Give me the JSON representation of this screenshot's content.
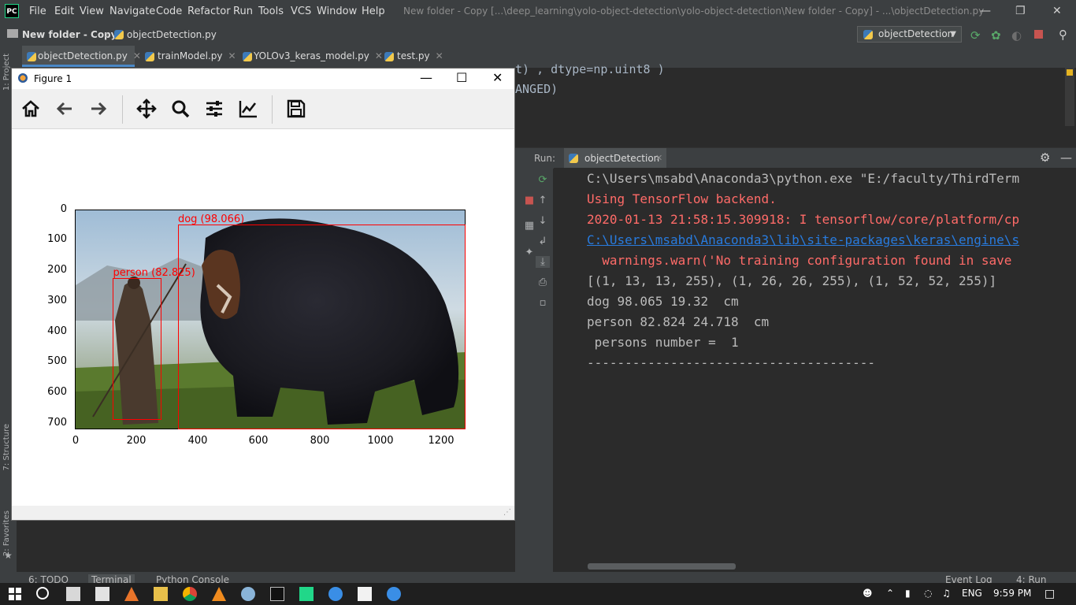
{
  "ide": {
    "logo_text": "PC",
    "menu": [
      "File",
      "Edit",
      "View",
      "Navigate",
      "Code",
      "Refactor",
      "Run",
      "Tools",
      "VCS",
      "Window",
      "Help"
    ],
    "title": "New folder - Copy [...\\deep_learning\\yolo-object-detection\\yolo-object-detection\\New folder - Copy] - ...\\objectDetection.py",
    "breadcrumb": [
      "New folder - Copy",
      "objectDetection.py"
    ],
    "run_config": "objectDetection",
    "tabs": [
      {
        "label": "objectDetection.py",
        "active": true
      },
      {
        "label": "trainModel.py",
        "active": false
      },
      {
        "label": "YOLOv3_keras_model.py",
        "active": false
      },
      {
        "label": "test.py",
        "active": false
      }
    ],
    "side_labels": [
      "1: Project",
      "7: Structure",
      "2: Favorites"
    ],
    "editor_lines": [
      "t) , dtype=np.uint8 )",
      "ANGED)"
    ],
    "run_label": "Run:",
    "run_tab": "objectDetection",
    "console": [
      {
        "text": "C:\\Users\\msabd\\Anaconda3\\python.exe \"E:/faculty/ThirdTerm",
        "style": "normal"
      },
      {
        "text": "Using TensorFlow backend.",
        "style": "red"
      },
      {
        "text": "2020-01-13 21:58:15.309918: I tensorflow/core/platform/cp",
        "style": "red"
      },
      {
        "text": "C:\\Users\\msabd\\Anaconda3\\lib\\site-packages\\keras\\engine\\s",
        "style": "link"
      },
      {
        "text": "  warnings.warn('No training configuration found in save",
        "style": "red"
      },
      {
        "text": "[(1, 13, 13, 255), (1, 26, 26, 255), (1, 52, 52, 255)]",
        "style": "normal"
      },
      {
        "text": "dog 98.065 19.32  cm",
        "style": "normal"
      },
      {
        "text": "person 82.824 24.718  cm",
        "style": "normal"
      },
      {
        "text": " persons number =  1",
        "style": "normal"
      },
      {
        "text": "--------------------------------------",
        "style": "normal"
      }
    ],
    "bottom_tools": [
      "6: TODO",
      "Terminal",
      "Python Console",
      "Event Log",
      "4: Run"
    ]
  },
  "figure": {
    "title": "Figure 1",
    "y_ticks": [
      "0",
      "100",
      "200",
      "300",
      "400",
      "500",
      "600",
      "700"
    ],
    "x_ticks": [
      "0",
      "200",
      "400",
      "600",
      "800",
      "1000",
      "1200"
    ],
    "detections": [
      {
        "label": "dog (98.066)",
        "x1": 338,
        "y1": 50,
        "x2": 1280,
        "y2": 720
      },
      {
        "label": "person (82.825)",
        "x1": 125,
        "y1": 225,
        "x2": 285,
        "y2": 688
      }
    ],
    "image_extent": {
      "width": 1280,
      "height": 720
    }
  },
  "taskbar": {
    "language": "ENG",
    "time": "9:59 PM"
  }
}
